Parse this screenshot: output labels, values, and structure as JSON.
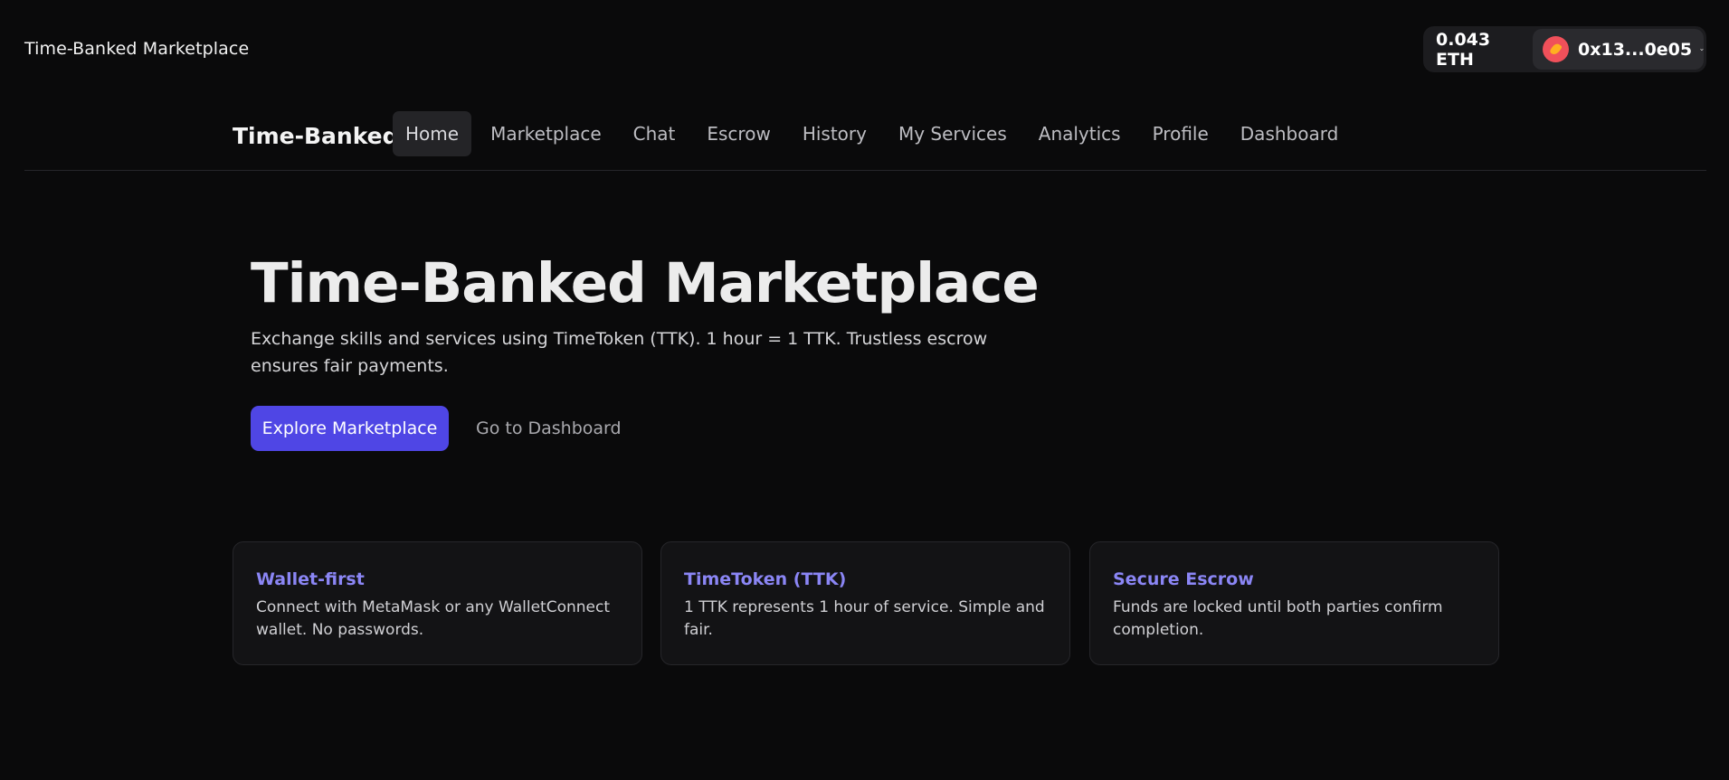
{
  "app": {
    "title": "Time-Banked Marketplace"
  },
  "wallet": {
    "balance": "0.043 ETH",
    "address": "0x13...0e05",
    "avatar_icon": "wallet-avatar-icon",
    "chevron_icon": "chevron-down-icon"
  },
  "nav": {
    "brand": "Time-Banked",
    "items": [
      {
        "label": "Home",
        "active": true
      },
      {
        "label": "Marketplace",
        "active": false
      },
      {
        "label": "Chat",
        "active": false
      },
      {
        "label": "Escrow",
        "active": false
      },
      {
        "label": "History",
        "active": false
      },
      {
        "label": "My Services",
        "active": false
      },
      {
        "label": "Analytics",
        "active": false
      },
      {
        "label": "Profile",
        "active": false
      },
      {
        "label": "Dashboard",
        "active": false
      }
    ]
  },
  "hero": {
    "title": "Time-Banked Marketplace",
    "subtitle": "Exchange skills and services using TimeToken (TTK). 1 hour = 1 TTK. Trustless escrow ensures fair payments.",
    "primary_button": "Explore Marketplace",
    "secondary_button": "Go to Dashboard"
  },
  "features": [
    {
      "title": "Wallet-first",
      "text": "Connect with MetaMask or any WalletConnect wallet. No passwords."
    },
    {
      "title": "TimeToken (TTK)",
      "text": "1 TTK represents 1 hour of service. Simple and fair."
    },
    {
      "title": "Secure Escrow",
      "text": "Funds are locked until both parties confirm completion."
    }
  ],
  "colors": {
    "background": "#0a0a0b",
    "accent": "#4f46e5",
    "feature_title": "#8b86f5",
    "avatar": "#f0505a"
  }
}
